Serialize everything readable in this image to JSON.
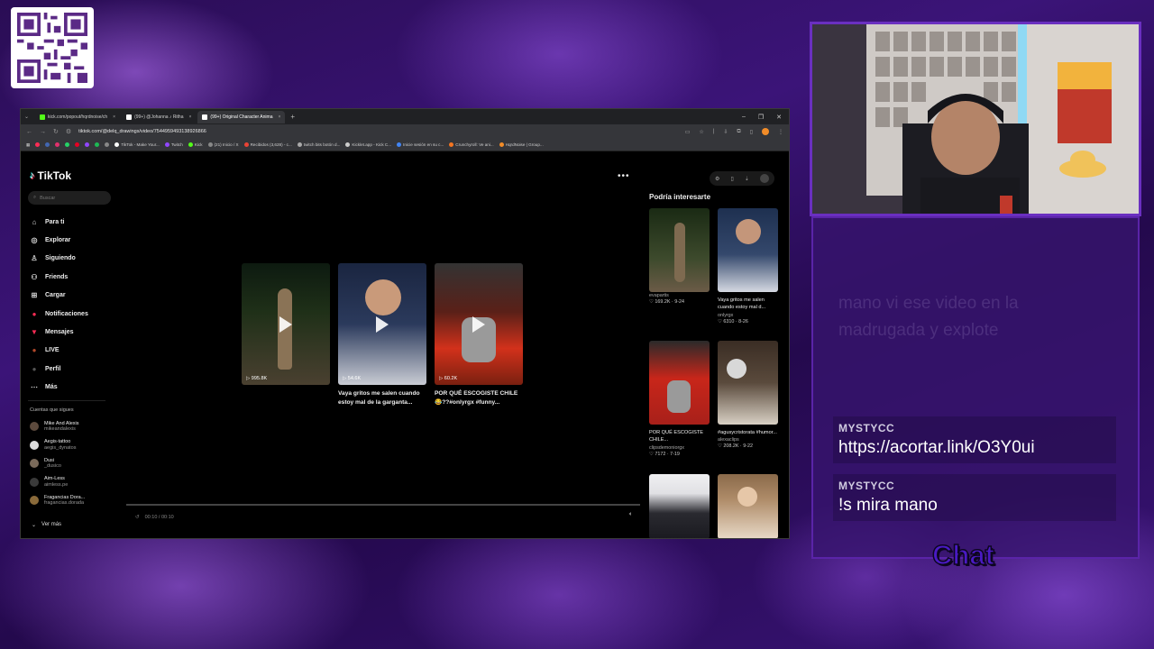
{
  "browser": {
    "tabs": [
      {
        "label": "kick.com/popout/hqrdnoise/ch",
        "fav_color": "#53fc18",
        "active": false
      },
      {
        "label": "(99+) @Johanna ♪ Ritha",
        "fav_color": "#ffffff",
        "active": false
      },
      {
        "label": "(99+) Original Character Anima",
        "fav_color": "#ffffff",
        "active": true
      }
    ],
    "new_tab_symbol": "+",
    "url": "tiktok.com/@delq_drawings/video/7544959493138926866",
    "bookmarks": [
      {
        "label": "TikTok - Make Your...",
        "color": "#ffffff"
      },
      {
        "label": "Twitch",
        "color": "#9146ff"
      },
      {
        "label": "Kick",
        "color": "#53fc18"
      },
      {
        "label": "(21) Inicio / X",
        "color": "#888888"
      },
      {
        "label": "Recibidos (3,628) - c...",
        "color": "#ea4335"
      },
      {
        "label": "twitch bits botón d...",
        "color": "#aaaaaa"
      },
      {
        "label": "Kicklet.app - Kick C...",
        "color": "#cccccc"
      },
      {
        "label": "Inicie sesión en su c...",
        "color": "#4285f4"
      },
      {
        "label": "Crunchyroll: Ve ani...",
        "color": "#f47521"
      },
      {
        "label": "HqrdNoise | Group...",
        "color": "#f28c28"
      }
    ]
  },
  "tiktok": {
    "logo": "TikTok",
    "search_placeholder": "Buscar",
    "nav": [
      {
        "label": "Para ti",
        "icon": "home-icon",
        "glyph": "⌂"
      },
      {
        "label": "Explorar",
        "icon": "compass-icon",
        "glyph": "◎"
      },
      {
        "label": "Siguiendo",
        "icon": "following-icon",
        "glyph": "♙"
      },
      {
        "label": "Friends",
        "icon": "friends-icon",
        "glyph": "⚇"
      },
      {
        "label": "Cargar",
        "icon": "upload-icon",
        "glyph": "⊞"
      },
      {
        "label": "Notificaciones",
        "icon": "notifications-icon",
        "glyph": "●",
        "color": "#fe2c55"
      },
      {
        "label": "Mensajes",
        "icon": "messages-icon",
        "glyph": "▼",
        "color": "#fe2c55"
      },
      {
        "label": "LIVE",
        "icon": "live-icon",
        "glyph": "●",
        "color": "#b2482a"
      },
      {
        "label": "Perfil",
        "icon": "profile-icon",
        "glyph": "●",
        "color": "#444444"
      },
      {
        "label": "Más",
        "icon": "more-icon",
        "glyph": "⋯"
      }
    ],
    "following_title": "Cuentas que sigues",
    "following": [
      {
        "name": "Mike And Alexis",
        "handle": "mikeandalexis"
      },
      {
        "name": "Aegis-tattoo",
        "handle": "aegis_dynatos"
      },
      {
        "name": "Dusi",
        "handle": "_dusico"
      },
      {
        "name": "Aim-Less",
        "handle": "aimless.pe"
      },
      {
        "name": "Fragancias Dora...",
        "handle": "fragancias.dorada"
      }
    ],
    "see_more": "Ver más",
    "grid": [
      {
        "views": "995.8K",
        "caption_line1": "",
        "caption_line2": "",
        "palette": [
          "#0f1a12",
          "#6b5a48",
          "#2e3a22"
        ]
      },
      {
        "views": "54.6K",
        "caption_line1": "Vaya gritos me salen cuando",
        "caption_line2": "estoy mal de la garganta...",
        "palette": [
          "#1b2a4a",
          "#cfd4de",
          "#22314d"
        ]
      },
      {
        "views": "60.2K",
        "caption_line1": "POR QUÉ ESCOGISTE CHILE",
        "caption_line2": "😂??#onlyrgx #funny...",
        "palette": [
          "#2a2020",
          "#d2311b",
          "#8a8a8a"
        ]
      }
    ],
    "player_time": "00:10 / 00:10",
    "suggested_title": "Podría interesarte",
    "suggested": [
      {
        "title": "",
        "author": "evapartis",
        "likes": "169.2K",
        "date": "9-24",
        "palette": [
          "#233a1c",
          "#6b5b47"
        ]
      },
      {
        "title": "Vaya gritos me salen cuando estoy mal d...",
        "author": "onlyrgx",
        "likes": "6310",
        "date": "8-26",
        "palette": [
          "#1e3050",
          "#d5d9e2"
        ]
      },
      {
        "title": "POR QUÉ ESCOGISTE CHILE...",
        "author": "clipsdemoniorgx",
        "likes": "7172",
        "date": "7-19",
        "palette": [
          "#c8261a",
          "#9a9a9a"
        ]
      },
      {
        "title": "#agusycristorata #humor...",
        "author": "alexaclips",
        "likes": "208.2K",
        "date": "9-22",
        "palette": [
          "#3a2d24",
          "#d8d0c4"
        ]
      },
      {
        "title": "",
        "author": "",
        "likes": "",
        "date": "",
        "palette": [
          "#2a2a30",
          "#e9e9ea"
        ]
      },
      {
        "title": "",
        "author": "",
        "likes": "",
        "date": "",
        "palette": [
          "#b08d6a",
          "#e8d9c7"
        ]
      }
    ]
  },
  "chat": {
    "faded_message": "mano vi ese video en la madrugada y explote",
    "messages": [
      {
        "user": "MYSTYCC",
        "text": "https://acortar.link/O3Y0ui"
      },
      {
        "user": "MYSTYCC",
        "text": "!s mira mano"
      }
    ],
    "label": "Chat"
  },
  "colors": {
    "accent_purple": "#6a2fc0",
    "tiktok_red": "#fe2c55",
    "tiktok_cyan": "#25f4ee"
  }
}
